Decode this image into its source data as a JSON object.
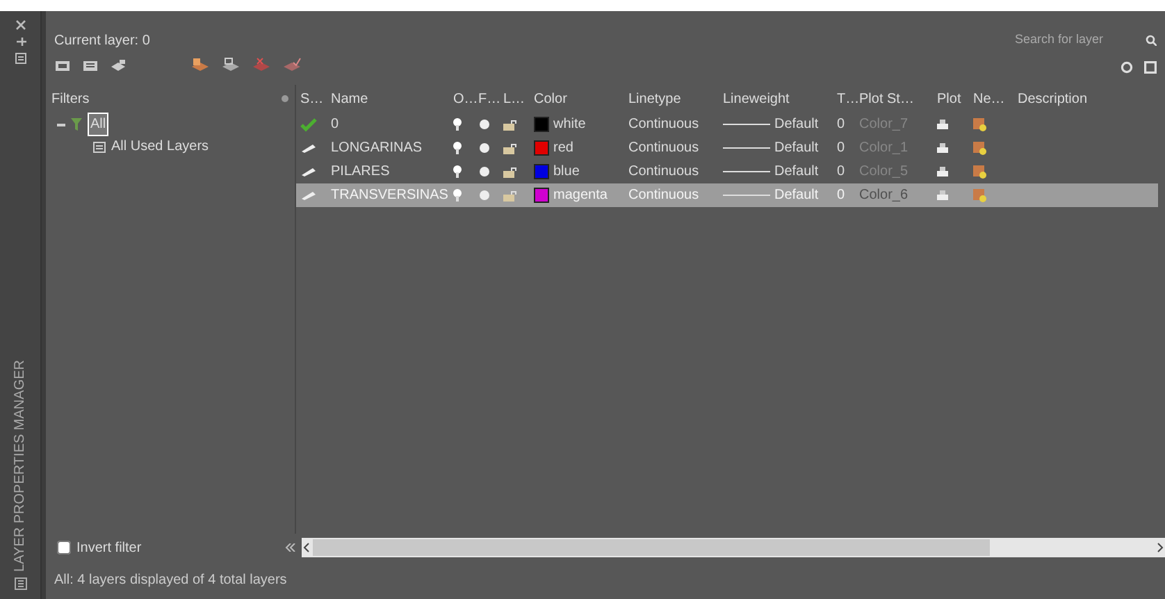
{
  "palette_title": "LAYER PROPERTIES MANAGER",
  "current_layer": "Current layer: 0",
  "search": {
    "placeholder": "Search for layer"
  },
  "filters": {
    "header": "Filters",
    "tree": [
      {
        "label": "All",
        "selected": true,
        "expanded": true,
        "children": [
          {
            "label": "All Used Layers",
            "selected": false
          }
        ]
      }
    ]
  },
  "columns": [
    "S…",
    "Name",
    "O…",
    "F…",
    "L…",
    "Color",
    "Linetype",
    "Lineweight",
    "T…",
    "Plot St…",
    "Plot",
    "Ne…",
    "Description"
  ],
  "rows": [
    {
      "kind": "current",
      "name": "0",
      "color_name": "white",
      "color": "#000000",
      "linetype": "Continuous",
      "lineweight": "Default",
      "transparency": "0",
      "plot_style": "Color_7",
      "selected": false
    },
    {
      "kind": "layer",
      "name": "LONGARINAS",
      "color_name": "red",
      "color": "#e00000",
      "linetype": "Continuous",
      "lineweight": "Default",
      "transparency": "0",
      "plot_style": "Color_1",
      "selected": false
    },
    {
      "kind": "layer",
      "name": "PILARES",
      "color_name": "blue",
      "color": "#0000e0",
      "linetype": "Continuous",
      "lineweight": "Default",
      "transparency": "0",
      "plot_style": "Color_5",
      "selected": false
    },
    {
      "kind": "layer",
      "name": "TRANSVERSINAS",
      "color_name": "magenta",
      "color": "#d000d0",
      "linetype": "Continuous",
      "lineweight": "Default",
      "transparency": "0",
      "plot_style": "Color_6",
      "selected": true
    }
  ],
  "invert_filter": {
    "label": "Invert filter",
    "checked": false
  },
  "status_bar": "All: 4 layers displayed of 4 total layers"
}
